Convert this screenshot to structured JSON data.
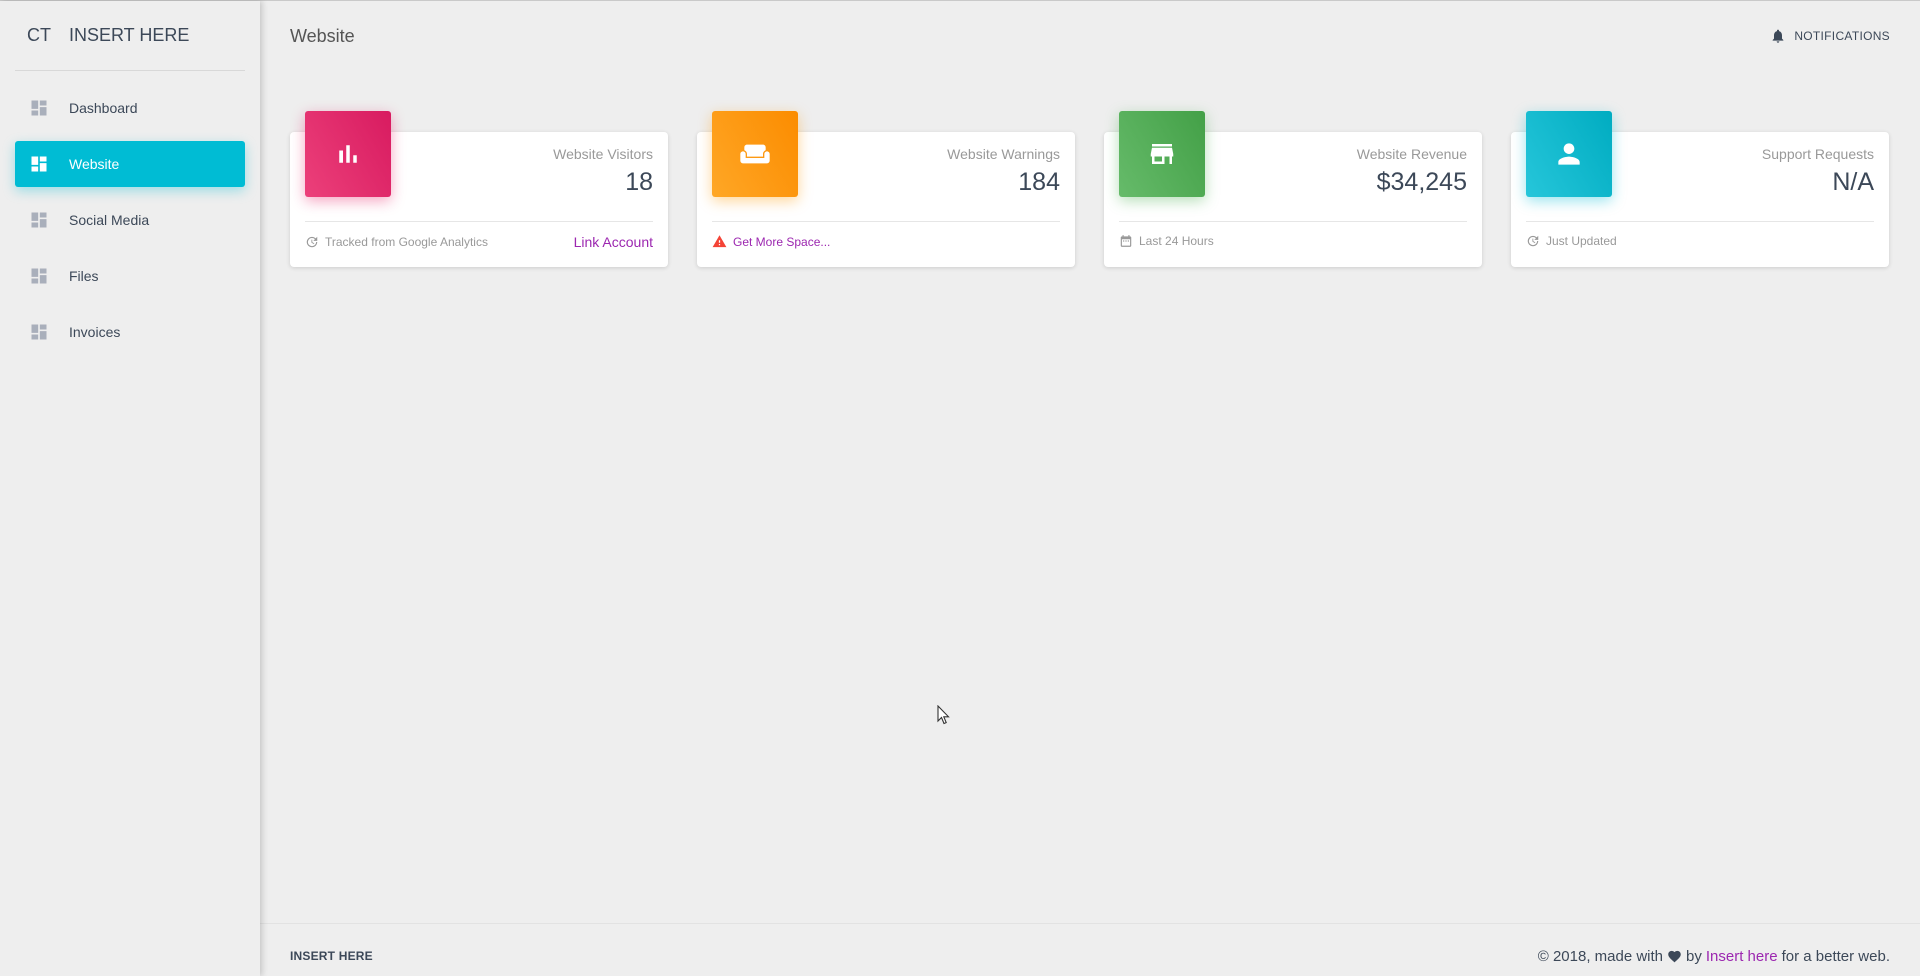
{
  "brand": {
    "mini": "CT",
    "name": "INSERT HERE"
  },
  "sidebar": {
    "items": [
      {
        "label": "Dashboard",
        "icon": "dashboard-icon",
        "active": false
      },
      {
        "label": "Website",
        "icon": "dashboard-icon",
        "active": true
      },
      {
        "label": "Social Media",
        "icon": "dashboard-icon",
        "active": false
      },
      {
        "label": "Files",
        "icon": "dashboard-icon",
        "active": false
      },
      {
        "label": "Invoices",
        "icon": "dashboard-icon",
        "active": false
      }
    ]
  },
  "header": {
    "title": "Website",
    "notifications_label": "NOTIFICATIONS"
  },
  "cards": [
    {
      "category": "Website Visitors",
      "value": "18",
      "icon": "bar-chart-icon",
      "color": "#e91e63",
      "footer_icon": "update-icon",
      "footer_text": "Tracked from Google Analytics",
      "link": "Link Account"
    },
    {
      "category": "Website Warnings",
      "value": "184",
      "icon": "weekend-sofa-icon",
      "color": "#ff9800",
      "footer_icon": "warning-icon",
      "footer_text": "Get More Space..."
    },
    {
      "category": "Website Revenue",
      "value": "$34,245",
      "icon": "store-icon",
      "color": "#4caf50",
      "footer_icon": "calendar-icon",
      "footer_text": "Last 24 Hours"
    },
    {
      "category": "Support Requests",
      "value": "N/A",
      "icon": "person-icon",
      "color": "#00bcd4",
      "footer_icon": "update-icon",
      "footer_text": "Just Updated"
    }
  ],
  "footer": {
    "brand": "INSERT HERE",
    "copyright_prefix": "© 2018, made with",
    "by": "by",
    "link": "Insert here",
    "suffix": "for a better web."
  },
  "colors": {
    "accent": "#00bcd4",
    "link": "#9c27b0"
  }
}
